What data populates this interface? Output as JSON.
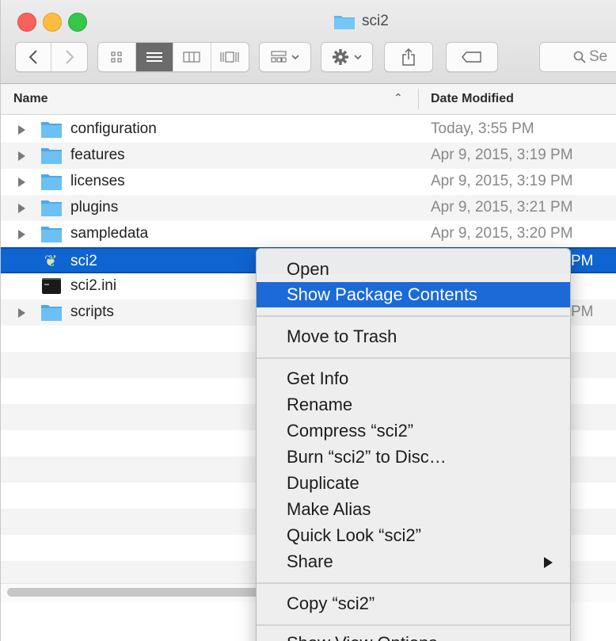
{
  "window": {
    "title": "sci2"
  },
  "toolbar": {
    "search_placeholder": "Se"
  },
  "columns": {
    "name": "Name",
    "date_modified": "Date Modified"
  },
  "files": [
    {
      "name": "configuration",
      "date": "Today, 3:55 PM",
      "kind": "folder"
    },
    {
      "name": "features",
      "date": "Apr 9, 2015, 3:19 PM",
      "kind": "folder"
    },
    {
      "name": "licenses",
      "date": "Apr 9, 2015, 3:19 PM",
      "kind": "folder"
    },
    {
      "name": "plugins",
      "date": "Apr 9, 2015, 3:21 PM",
      "kind": "folder"
    },
    {
      "name": "sampledata",
      "date": "Apr 9, 2015, 3:20 PM",
      "kind": "folder"
    },
    {
      "name": "sci2",
      "date": "PM",
      "kind": "app"
    },
    {
      "name": "sci2.ini",
      "date": "",
      "kind": "file"
    },
    {
      "name": "scripts",
      "date": "PM",
      "kind": "folder"
    }
  ],
  "context_menu": {
    "items": [
      "Open",
      "Show Package Contents",
      "Move to Trash",
      "Get Info",
      "Rename",
      "Compress “sci2”",
      "Burn “sci2” to Disc…",
      "Duplicate",
      "Make Alias",
      "Quick Look “sci2”",
      "Share",
      "Copy “sci2”",
      "Show View Options"
    ]
  },
  "colors": {
    "selection": "#0f64d2",
    "menu_highlight": "#1b6ad8",
    "folder": "#5bb6ec"
  }
}
